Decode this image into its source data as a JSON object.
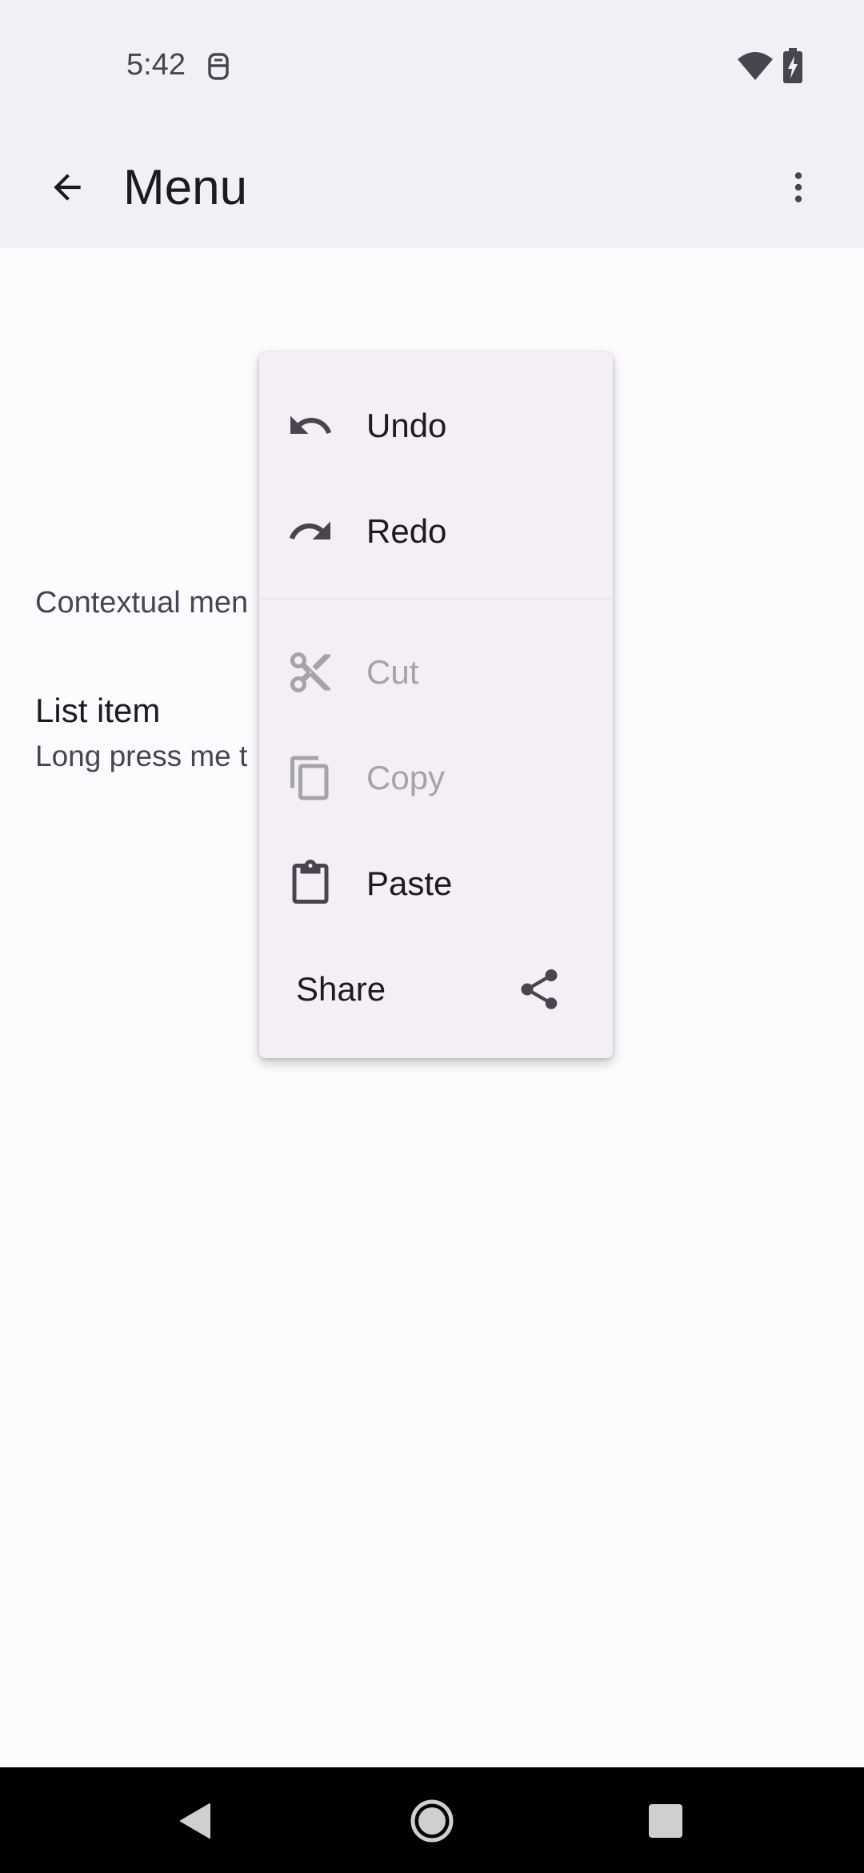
{
  "status_bar": {
    "time": "5:42",
    "app_icon": "launcher-notification-icon",
    "wifi_icon": "wifi-icon",
    "battery_icon": "battery-charging-icon"
  },
  "app_bar": {
    "title": "Menu",
    "back_icon": "arrow-back-icon",
    "overflow_icon": "more-vert-icon"
  },
  "content": {
    "contextual_label": "Contextual men",
    "list_item": {
      "headline": "List item",
      "supporting": "Long press me t"
    }
  },
  "menu": {
    "items": [
      {
        "label": "Undo",
        "icon": "undo-icon",
        "enabled": true
      },
      {
        "label": "Redo",
        "icon": "redo-icon",
        "enabled": true
      },
      {
        "label": "Cut",
        "icon": "scissors-icon",
        "enabled": false
      },
      {
        "label": "Copy",
        "icon": "copy-icon",
        "enabled": false
      },
      {
        "label": "Paste",
        "icon": "clipboard-icon",
        "enabled": true
      },
      {
        "label": "Share",
        "icon": "share-icon",
        "enabled": true
      }
    ]
  },
  "nav_bar": {
    "back_icon": "nav-back-icon",
    "home_icon": "nav-home-icon",
    "recents_icon": "nav-recents-icon"
  },
  "colors": {
    "surface": "#fdfbfe",
    "app_bar": "#f2eff5",
    "menu_surface": "#f3eff5",
    "on_surface": "#1d1b20",
    "on_surface_variant": "#49454f",
    "disabled": "#a5a2a9"
  }
}
